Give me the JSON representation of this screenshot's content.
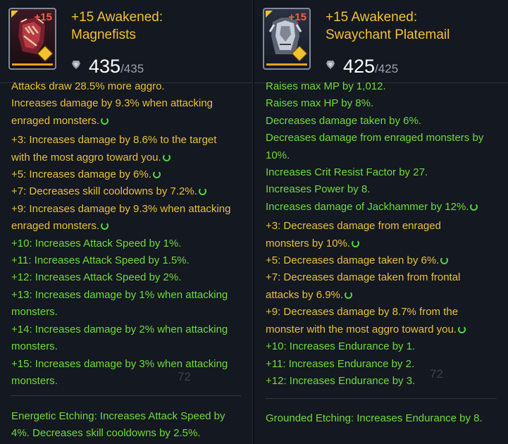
{
  "left": {
    "name_line1": "+15 Awakened:",
    "name_line2": "Magnefists",
    "icon_badge": "+15",
    "score": "435",
    "score_max": "/435",
    "watermark": "72",
    "lines": [
      {
        "text": "Attacks draw 28.5% more aggro.",
        "color": "y",
        "cycle": false
      },
      {
        "text": "Increases damage by 9.3% when attacking",
        "color": "y",
        "cycle": false
      },
      {
        "text": "enraged monsters.",
        "color": "y",
        "cycle": true
      },
      {
        "text": "+3: Increases damage by 8.6% to the target",
        "color": "y",
        "cycle": false,
        "gap": true
      },
      {
        "text": "with the most aggro toward you.",
        "color": "y",
        "cycle": true
      },
      {
        "text": "+5: Increases damage by 6%.",
        "color": "y",
        "cycle": true
      },
      {
        "text": "+7: Decreases skill cooldowns by 7.2%.",
        "color": "y",
        "cycle": true
      },
      {
        "text": "+9: Increases damage by 9.3% when attacking",
        "color": "y",
        "cycle": false
      },
      {
        "text": "enraged monsters.",
        "color": "y",
        "cycle": true
      },
      {
        "text": "+10: Increases Attack Speed by 1%.",
        "color": "g",
        "cycle": false
      },
      {
        "text": "+11: Increases Attack Speed by 1.5%.",
        "color": "g",
        "cycle": false
      },
      {
        "text": "+12: Increases Attack Speed by 2%.",
        "color": "g",
        "cycle": false
      },
      {
        "text": "+13: Increases damage by 1% when attacking",
        "color": "g",
        "cycle": false
      },
      {
        "text": "monsters.",
        "color": "g",
        "cycle": false
      },
      {
        "text": "+14: Increases damage by 2% when attacking",
        "color": "g",
        "cycle": false
      },
      {
        "text": "monsters.",
        "color": "g",
        "cycle": false
      },
      {
        "text": "+15: Increases damage by 3% when attacking",
        "color": "g",
        "cycle": false
      },
      {
        "text": "monsters.",
        "color": "g",
        "cycle": false
      }
    ],
    "etching_line1": "Energetic Etching: Increases Attack Speed by",
    "etching_line2": "4%. Decreases skill cooldowns by 2.5%."
  },
  "right": {
    "name_line1": "+15 Awakened:",
    "name_line2": "Swaychant Platemail",
    "icon_badge": "+15",
    "score": "425",
    "score_max": "/425",
    "watermark": "72",
    "lines": [
      {
        "text": "Raises max MP by 1,012.",
        "color": "g",
        "cycle": false
      },
      {
        "text": "Raises max HP by 8%.",
        "color": "g",
        "cycle": false
      },
      {
        "text": "Decreases damage taken by 6%.",
        "color": "g",
        "cycle": false
      },
      {
        "text": "Decreases damage from enraged monsters by",
        "color": "g",
        "cycle": false
      },
      {
        "text": "10%.",
        "color": "g",
        "cycle": false
      },
      {
        "text": "Increases Crit Resist Factor by 27.",
        "color": "g",
        "cycle": false
      },
      {
        "text": "Increases Power by 8.",
        "color": "g",
        "cycle": false
      },
      {
        "text": "Increases damage of Jackhammer by 12%.",
        "color": "g",
        "cycle": true
      },
      {
        "text": "+3: Decreases damage from enraged",
        "color": "y",
        "cycle": false,
        "gap": true
      },
      {
        "text": "monsters by 10%.",
        "color": "y",
        "cycle": true
      },
      {
        "text": "+5: Decreases damage taken by 6%.",
        "color": "y",
        "cycle": true
      },
      {
        "text": "+7: Decreases damage taken from frontal",
        "color": "y",
        "cycle": false
      },
      {
        "text": "attacks by 6.9%.",
        "color": "y",
        "cycle": true
      },
      {
        "text": "+9: Decreases damage by 8.7% from the",
        "color": "y",
        "cycle": false
      },
      {
        "text": "monster with the most aggro toward you.",
        "color": "y",
        "cycle": true
      },
      {
        "text": "+10: Increases Endurance by 1.",
        "color": "g",
        "cycle": false
      },
      {
        "text": "+11: Increases Endurance by 2.",
        "color": "g",
        "cycle": false
      },
      {
        "text": "+12: Increases Endurance by 3.",
        "color": "g",
        "cycle": false
      }
    ],
    "etching_line1": "Grounded Etching: Increases Endurance by 8."
  }
}
